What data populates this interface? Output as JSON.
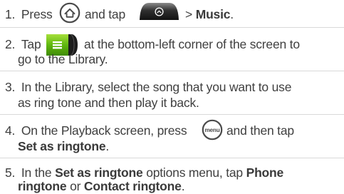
{
  "steps": [
    {
      "number": "1.",
      "line1": {
        "a": "Press",
        "b": "and tap",
        "c": "> ",
        "d": "Music",
        "e": "."
      }
    },
    {
      "number": "2.",
      "line1": {
        "a": "Tap",
        "b": "at the bottom-left corner of the screen to"
      },
      "line2": {
        "a": "go to the Library."
      }
    },
    {
      "number": "3.",
      "line1": {
        "a": "In the Library, select the song that you want to use"
      },
      "line2": {
        "a": "as ring tone and then play it back."
      }
    },
    {
      "number": "4.",
      "line1": {
        "a": "On the Playback screen, press",
        "b": "and then tap"
      },
      "line2": {
        "a": "Set as ringtone",
        "b": "."
      }
    },
    {
      "number": "5.",
      "line1": {
        "a": "In the ",
        "b": "Set as ringtone",
        "c": " options menu, tap ",
        "d": "Phone"
      },
      "line2": {
        "a": "ringtone",
        "b": " or ",
        "c": "Contact ringtone",
        "d": "."
      }
    }
  ],
  "icons": {
    "home_key": "home-key-icon",
    "launcher_tab": "launcher-tab-icon",
    "menu_tab": "menu-tab-icon",
    "menu_key": "menu-key-icon",
    "home_key_label": "",
    "menu_key_text": "menu"
  }
}
